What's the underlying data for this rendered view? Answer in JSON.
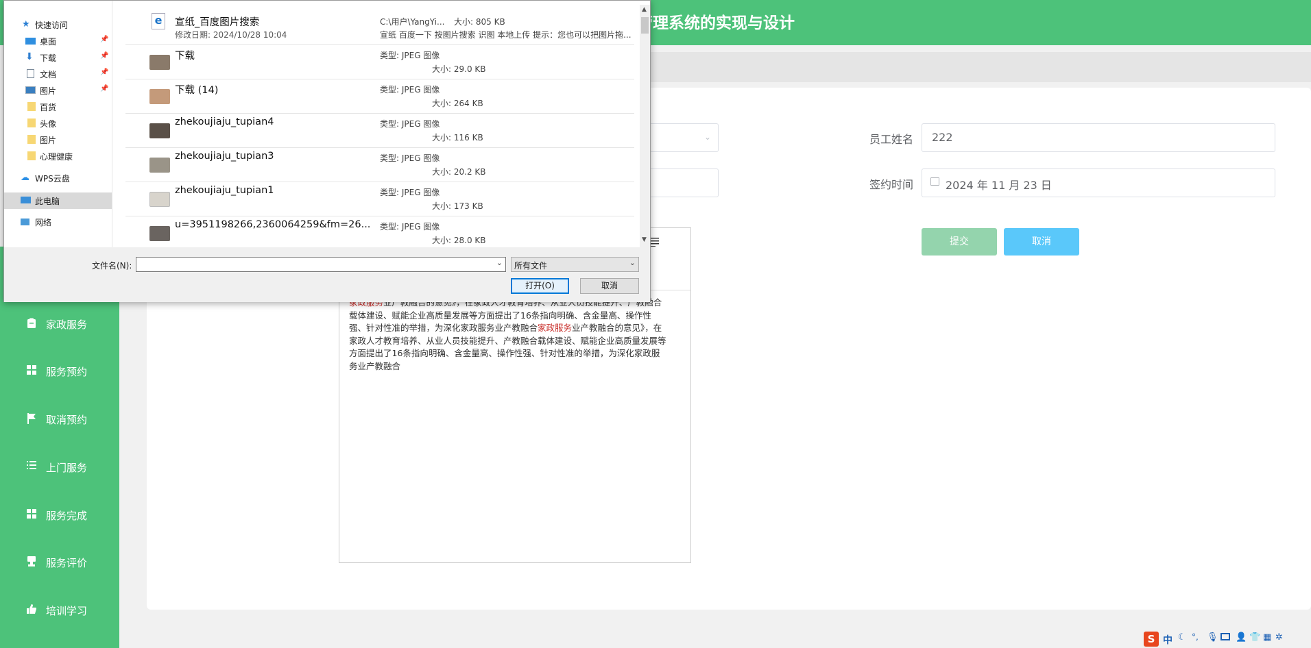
{
  "app": {
    "header_title": "政服务管理系统的实现与设计"
  },
  "sidebar": {
    "items": [
      {
        "label": "家政服务",
        "icon": "clipboard-icon"
      },
      {
        "label": "服务预约",
        "icon": "grid-icon"
      },
      {
        "label": "取消预约",
        "icon": "flag-icon"
      },
      {
        "label": "上门服务",
        "icon": "list-icon"
      },
      {
        "label": "服务完成",
        "icon": "grid-icon"
      },
      {
        "label": "服务评价",
        "icon": "stamp-icon"
      },
      {
        "label": "培训学习",
        "icon": "thumb-icon"
      }
    ]
  },
  "form": {
    "employee_name_label": "员工姓名",
    "employee_name_value": "222",
    "sign_time_label": "签约时间",
    "sign_time_value": "2024 年 11 月 23 日",
    "submit_label": "提交",
    "cancel_label": "取消",
    "editor_toolbar_icon": "list-icon",
    "editor_text": {
      "line1_hl": "家政服务",
      "line1_rest": "业产教融合的意见》，在家政人才教育培养、从业人员技能提升、产教融合",
      "line2": "载体建设、赋能企业高质量发展等方面提出了16条指向明确、含金量高、操作性",
      "line3a": "强、针对性准的举措，为深化家政服务业产教融合",
      "line3_hl": "家政服务",
      "line3b": "业产教融合的意见》，在",
      "line4": "家政人才教育培养、从业人员技能提升、产教融合载体建设、赋能企业高质量发展等",
      "line5": "方面提出了16条指向明确、含金量高、操作性强、针对性准的举措，为深化家政服",
      "line6": "务业产教融合"
    }
  },
  "dialog": {
    "nav": [
      {
        "label": "快速访问",
        "icon": "star-icon",
        "pinned": false
      },
      {
        "label": "桌面",
        "icon": "desktop-icon",
        "pinned": true
      },
      {
        "label": "下载",
        "icon": "download-icon",
        "pinned": true
      },
      {
        "label": "文档",
        "icon": "document-icon",
        "pinned": true
      },
      {
        "label": "图片",
        "icon": "picture-icon",
        "pinned": true
      },
      {
        "label": "百货",
        "icon": "folder-icon",
        "pinned": false
      },
      {
        "label": "头像",
        "icon": "folder-icon",
        "pinned": false
      },
      {
        "label": "图片",
        "icon": "folder-icon",
        "pinned": false
      },
      {
        "label": "心理健康",
        "icon": "folder-icon",
        "pinned": false
      },
      {
        "label": "WPS云盘",
        "icon": "cloud-icon",
        "pinned": false
      },
      {
        "label": "此电脑",
        "icon": "computer-icon",
        "pinned": false
      },
      {
        "label": "网络",
        "icon": "network-icon",
        "pinned": false
      }
    ],
    "top_file": {
      "name": "宣纸_百度图片搜索",
      "modified": "修改日期: 2024/10/28 10:04",
      "path": "C:\\用户\\YangYi...",
      "size": "大小: 805 KB",
      "desc": "宣纸 百度一下 按图片搜索 识图 本地上传 提示：您也可以把图片拖..."
    },
    "files": [
      {
        "name": "下载",
        "type": "类型: JPEG 图像",
        "size": "大小: 29.0 KB",
        "color": "#8a7a6a"
      },
      {
        "name": "下载 (14)",
        "type": "类型: JPEG 图像",
        "size": "大小: 264 KB",
        "color": "#c49a7a"
      },
      {
        "name": "zhekoujiaju_tupian4",
        "type": "类型: JPEG 图像",
        "size": "大小: 116 KB",
        "color": "#5a5048"
      },
      {
        "name": "zhekoujiaju_tupian3",
        "type": "类型: JPEG 图像",
        "size": "大小: 20.2 KB",
        "color": "#9a9488"
      },
      {
        "name": "zhekoujiaju_tupian1",
        "type": "类型: JPEG 图像",
        "size": "大小: 173 KB",
        "color": "#d8d4cc"
      },
      {
        "name": "u=3951198266,2360064259&fm=26...",
        "type": "类型: JPEG 图像",
        "size": "大小: 28.0 KB",
        "color": "#6a6460"
      }
    ],
    "filename_label": "文件名(N):",
    "filename_value": "",
    "filter_value": "所有文件",
    "open_label": "打开(O)",
    "cancel_label": "取消"
  },
  "ime": {
    "logo": "S",
    "mode": "中"
  }
}
